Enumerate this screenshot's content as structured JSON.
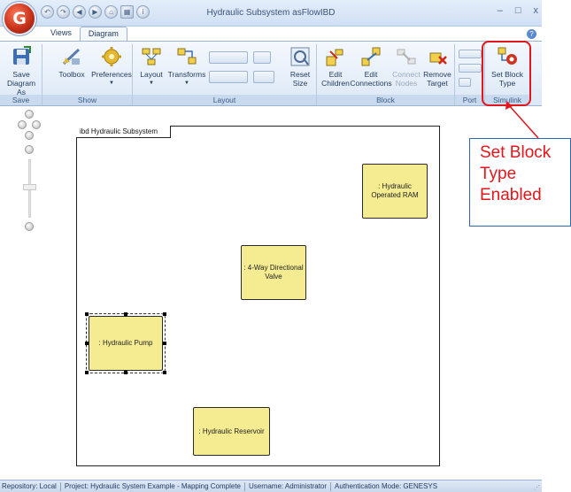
{
  "window": {
    "title": "Hydraulic Subsystem asFlowIBD",
    "app_icon": "genesys-logo-icon",
    "controls": {
      "minimize": "–",
      "maximize": "□",
      "close": "x"
    }
  },
  "quick_access": [
    {
      "icon": "undo-icon",
      "glyph": "↶"
    },
    {
      "icon": "redo-icon",
      "glyph": "↷"
    },
    {
      "icon": "back-icon",
      "glyph": "◀"
    },
    {
      "icon": "forward-icon",
      "glyph": "▶"
    },
    {
      "icon": "home-icon",
      "glyph": "⌂"
    },
    {
      "icon": "calendar-icon",
      "glyph": "▦"
    },
    {
      "icon": "info-icon",
      "glyph": "i"
    }
  ],
  "tabs": [
    {
      "label": "Views",
      "active": false
    },
    {
      "label": "Diagram",
      "active": true
    }
  ],
  "ribbon": {
    "groups": {
      "save": "Save",
      "show": "Show",
      "layout": "Layout",
      "block": "Block",
      "port": "Port",
      "simulink": "Simulink"
    },
    "buttons": {
      "save_diagram_as": "Save Diagram As",
      "toolbox": "Toolbox",
      "preferences": "Preferences",
      "layout": "Layout",
      "transforms": "Transforms",
      "reset_size": "Reset Size",
      "edit_children": "Edit Children",
      "edit_connections": "Edit Connections",
      "connect_nodes": "Connect Nodes",
      "remove_target": "Remove Target",
      "set_block_type": "Set Block Type"
    }
  },
  "diagram": {
    "frame_title": "ibd Hydraulic Subsystem",
    "blocks": [
      {
        "label": ": Hydraulic Operated RAM",
        "selected": false
      },
      {
        "label": ": 4-Way Directional Valve",
        "selected": false
      },
      {
        "label": ": Hydraulic Pump",
        "selected": true
      },
      {
        "label": ": Hydraulic Reservoir",
        "selected": false
      }
    ]
  },
  "callout": {
    "lines": [
      "Set Block",
      "Type",
      "Enabled"
    ],
    "color": "#e0171c"
  },
  "statusbar": {
    "repository": "Repository: Local",
    "project": "Project: Hydraulic System Example - Mapping Complete",
    "username": "Username: Administrator",
    "auth": "Authentication Mode: GENESYS"
  }
}
